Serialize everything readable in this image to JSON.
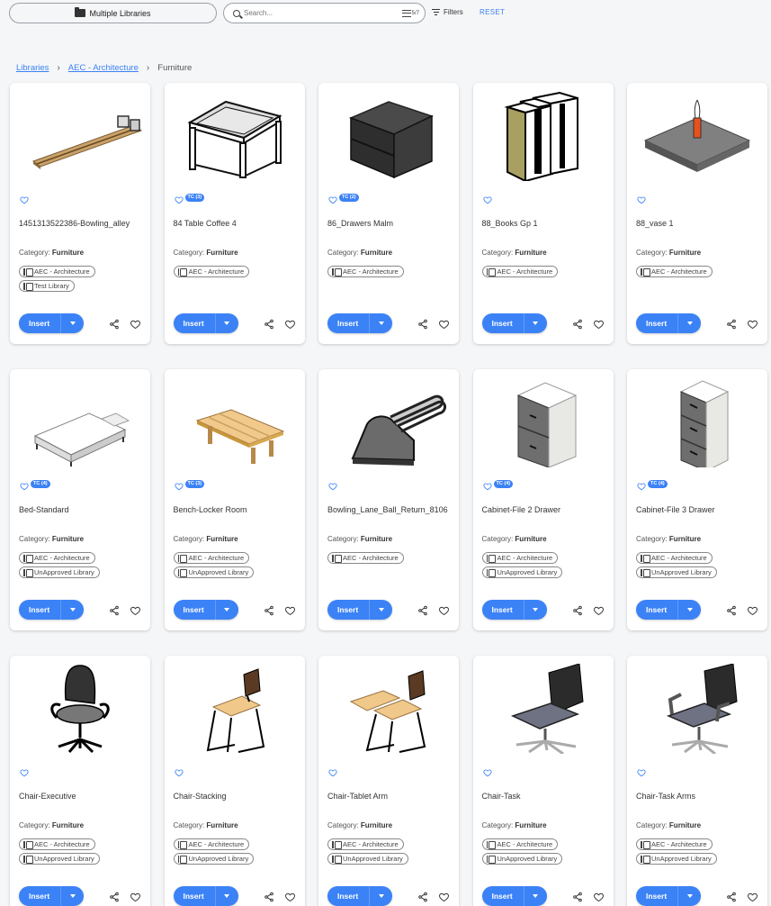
{
  "topbar": {
    "library_selector": "Multiple Libraries",
    "search_placeholder": "Search...",
    "search_count": "5/7",
    "filters_label": "Filters",
    "reset_label": "RESET"
  },
  "breadcrumb": {
    "items": [
      "Libraries",
      "AEC - Architecture"
    ],
    "current": "Furniture"
  },
  "card_labels": {
    "category_prefix": "Category:",
    "insert": "Insert"
  },
  "colors": {
    "accent": "#3b82f6"
  },
  "cards": [
    {
      "title": "1451313522386-Bowling_alley",
      "tc": "",
      "category": "Furniture",
      "libraries": [
        "AEC - Architecture",
        "Test Library"
      ],
      "icon": "bowling-alley"
    },
    {
      "title": "84 Table Coffee 4",
      "tc": "TC (3)",
      "category": "Furniture",
      "libraries": [
        "AEC - Architecture"
      ],
      "icon": "coffee-table"
    },
    {
      "title": "86_Drawers Malm",
      "tc": "TC (2)",
      "category": "Furniture",
      "libraries": [
        "AEC - Architecture"
      ],
      "icon": "drawers"
    },
    {
      "title": "88_Books Gp 1",
      "tc": "",
      "category": "Furniture",
      "libraries": [
        "AEC - Architecture"
      ],
      "icon": "books"
    },
    {
      "title": "88_vase 1",
      "tc": "",
      "category": "Furniture",
      "libraries": [
        "AEC - Architecture"
      ],
      "icon": "vase"
    },
    {
      "title": "Bed-Standard",
      "tc": "TC (4)",
      "category": "Furniture",
      "libraries": [
        "AEC - Architecture",
        "UnApproved Library"
      ],
      "icon": "bed"
    },
    {
      "title": "Bench-Locker Room",
      "tc": "TC (3)",
      "category": "Furniture",
      "libraries": [
        "AEC - Architecture",
        "UnApproved Library"
      ],
      "icon": "bench"
    },
    {
      "title": "Bowling_Lane_Ball_Return_8106",
      "tc": "",
      "category": "Furniture",
      "libraries": [
        "AEC - Architecture"
      ],
      "icon": "ball-return"
    },
    {
      "title": "Cabinet-File 2 Drawer",
      "tc": "TC (4)",
      "category": "Furniture",
      "libraries": [
        "AEC - Architecture",
        "UnApproved Library"
      ],
      "icon": "cabinet-2"
    },
    {
      "title": "Cabinet-File 3 Drawer",
      "tc": "TC (4)",
      "category": "Furniture",
      "libraries": [
        "AEC - Architecture",
        "UnApproved Library"
      ],
      "icon": "cabinet-3"
    },
    {
      "title": "Chair-Executive",
      "tc": "",
      "category": "Furniture",
      "libraries": [
        "AEC - Architecture",
        "UnApproved Library"
      ],
      "icon": "chair-executive"
    },
    {
      "title": "Chair-Stacking",
      "tc": "",
      "category": "Furniture",
      "libraries": [
        "AEC - Architecture",
        "UnApproved Library"
      ],
      "icon": "chair-stacking"
    },
    {
      "title": "Chair-Tablet Arm",
      "tc": "",
      "category": "Furniture",
      "libraries": [
        "AEC - Architecture",
        "UnApproved Library"
      ],
      "icon": "chair-tablet"
    },
    {
      "title": "Chair-Task",
      "tc": "",
      "category": "Furniture",
      "libraries": [
        "AEC - Architecture",
        "UnApproved Library"
      ],
      "icon": "chair-task"
    },
    {
      "title": "Chair-Task Arms",
      "tc": "",
      "category": "Furniture",
      "libraries": [
        "AEC - Architecture",
        "UnApproved Library"
      ],
      "icon": "chair-task-arms"
    }
  ]
}
